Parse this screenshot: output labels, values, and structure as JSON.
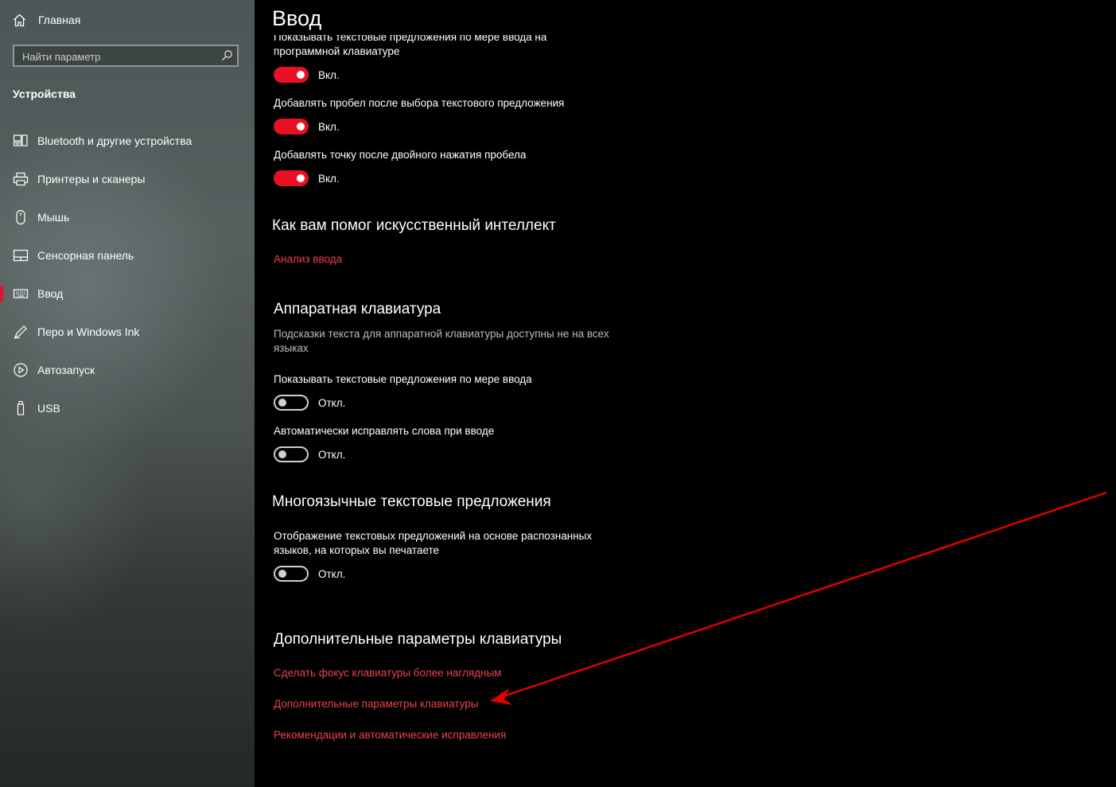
{
  "sidebar": {
    "home_label": "Главная",
    "search_placeholder": "Найти параметр",
    "section_label": "Устройства",
    "items": [
      {
        "label": "Bluetooth и другие устройства",
        "icon": "bluetooth-devices-icon"
      },
      {
        "label": "Принтеры и сканеры",
        "icon": "printer-icon"
      },
      {
        "label": "Мышь",
        "icon": "mouse-icon"
      },
      {
        "label": "Сенсорная панель",
        "icon": "touchpad-icon"
      },
      {
        "label": "Ввод",
        "icon": "keyboard-icon",
        "selected": true
      },
      {
        "label": "Перо и Windows Ink",
        "icon": "pen-icon"
      },
      {
        "label": "Автозапуск",
        "icon": "autoplay-icon"
      },
      {
        "label": "USB",
        "icon": "usb-icon"
      }
    ]
  },
  "main": {
    "title": "Ввод",
    "software": {
      "opt1": {
        "label_line1": "Показывать текстовые предложения по мере ввода на",
        "label_line2": "программной клавиатуре",
        "state": "Вкл."
      },
      "opt2": {
        "label": "Добавлять пробел после выбора текстового предложения",
        "state": "Вкл."
      },
      "opt3": {
        "label": "Добавлять точку после двойного нажатия пробела",
        "state": "Вкл."
      }
    },
    "ai": {
      "heading": "Как вам помог искусственный интеллект",
      "link": "Анализ ввода"
    },
    "hardware": {
      "heading": "Аппаратная клавиатура",
      "desc_line1": "Подсказки текста для аппаратной клавиатуры доступны не на всех",
      "desc_line2": "языках",
      "opt1": {
        "label": "Показывать текстовые предложения по мере ввода",
        "state": "Откл."
      },
      "opt2": {
        "label": "Автоматически исправлять слова при вводе",
        "state": "Откл."
      }
    },
    "multilang": {
      "heading": "Многоязычные текстовые предложения",
      "opt_line1": "Отображение текстовых предложений на основе распознанных",
      "opt_line2": "языков, на которых вы печатаете",
      "state": "Откл."
    },
    "advanced": {
      "heading": "Дополнительные параметры клавиатуры",
      "links": [
        "Сделать фокус клавиатуры более наглядным",
        "Дополнительные параметры клавиатуры",
        "Рекомендации и автоматические исправления"
      ]
    }
  },
  "colors": {
    "accent": "#e81123",
    "link": "#e8434f",
    "annotation_arrow": "#e00000"
  },
  "annotation": {
    "type": "arrow",
    "points_to": "Дополнительные параметры клавиатуры"
  }
}
